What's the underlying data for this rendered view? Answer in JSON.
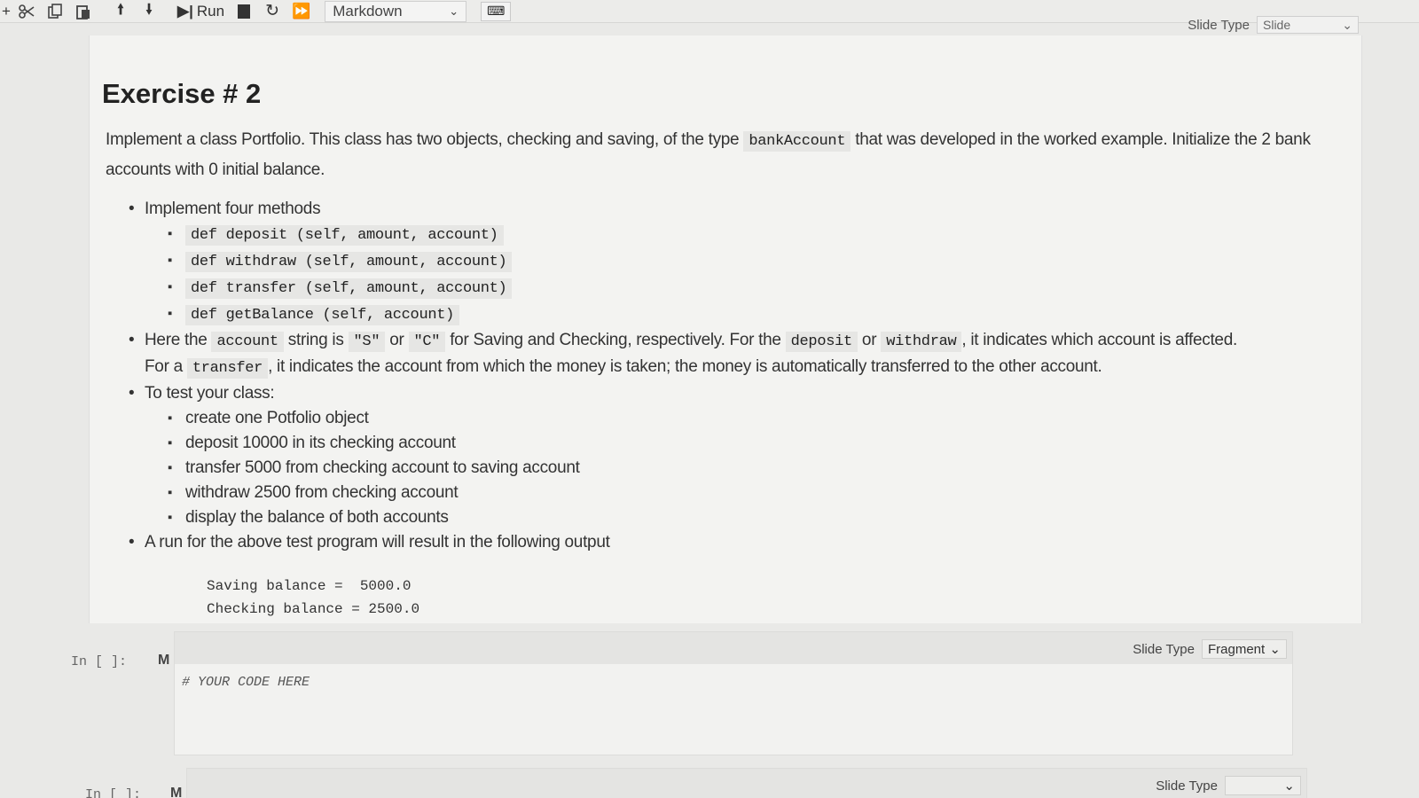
{
  "toolbar": {
    "run_label": "Run",
    "cell_type": "Markdown"
  },
  "top_slide": {
    "label": "Slide Type",
    "value": "Slide"
  },
  "markdown": {
    "title": "Exercise # 2",
    "intro_1": "Implement a class Portfolio. This class has two objects, checking and saving, of the type",
    "intro_code": "bankAccount",
    "intro_2": "that was developed in the worked example. Initialize the 2 bank accounts with 0 initial balance.",
    "methods_heading": "Implement four methods",
    "methods": [
      "def deposit (self, amount, account)",
      "def withdraw (self, amount, account)",
      "def transfer (self, amount, account)",
      "def getBalance (self, account)"
    ],
    "here_1": "Here the",
    "here_code_account": "account",
    "here_2": "string is",
    "here_code_s": "\"S\"",
    "here_or": "or",
    "here_code_c": "\"C\"",
    "here_3": "for Saving and Checking, respectively. For the",
    "here_code_deposit": "deposit",
    "here_or2": "or",
    "here_code_withdraw": "withdraw",
    "here_4": ", it indicates which account is affected.",
    "for_1": "For a",
    "for_code_transfer": "transfer",
    "for_2": ", it indicates the account from which the money is taken; the money is automatically transferred to the other account.",
    "test_heading": "To test your class:",
    "tests": [
      "create one Potfolio object",
      "deposit 10000 in its checking account",
      "transfer 5000 from checking account to saving account",
      "withdraw 2500 from checking account",
      "display the balance of both accounts"
    ],
    "output_heading": "A run for the above test program will result in the following output",
    "output_lines": [
      "Saving balance =  5000.0",
      "Checking balance = 2500.0"
    ]
  },
  "code_cell_1": {
    "prompt": "In [ ]:",
    "mode": "M",
    "slide_type_label": "Slide Type",
    "slide_type_value": "Fragment",
    "code": "# YOUR CODE HERE"
  },
  "code_cell_2": {
    "prompt": "In [ ]:",
    "mode": "M",
    "slide_type_label": "Slide Type",
    "slide_type_value": ""
  }
}
